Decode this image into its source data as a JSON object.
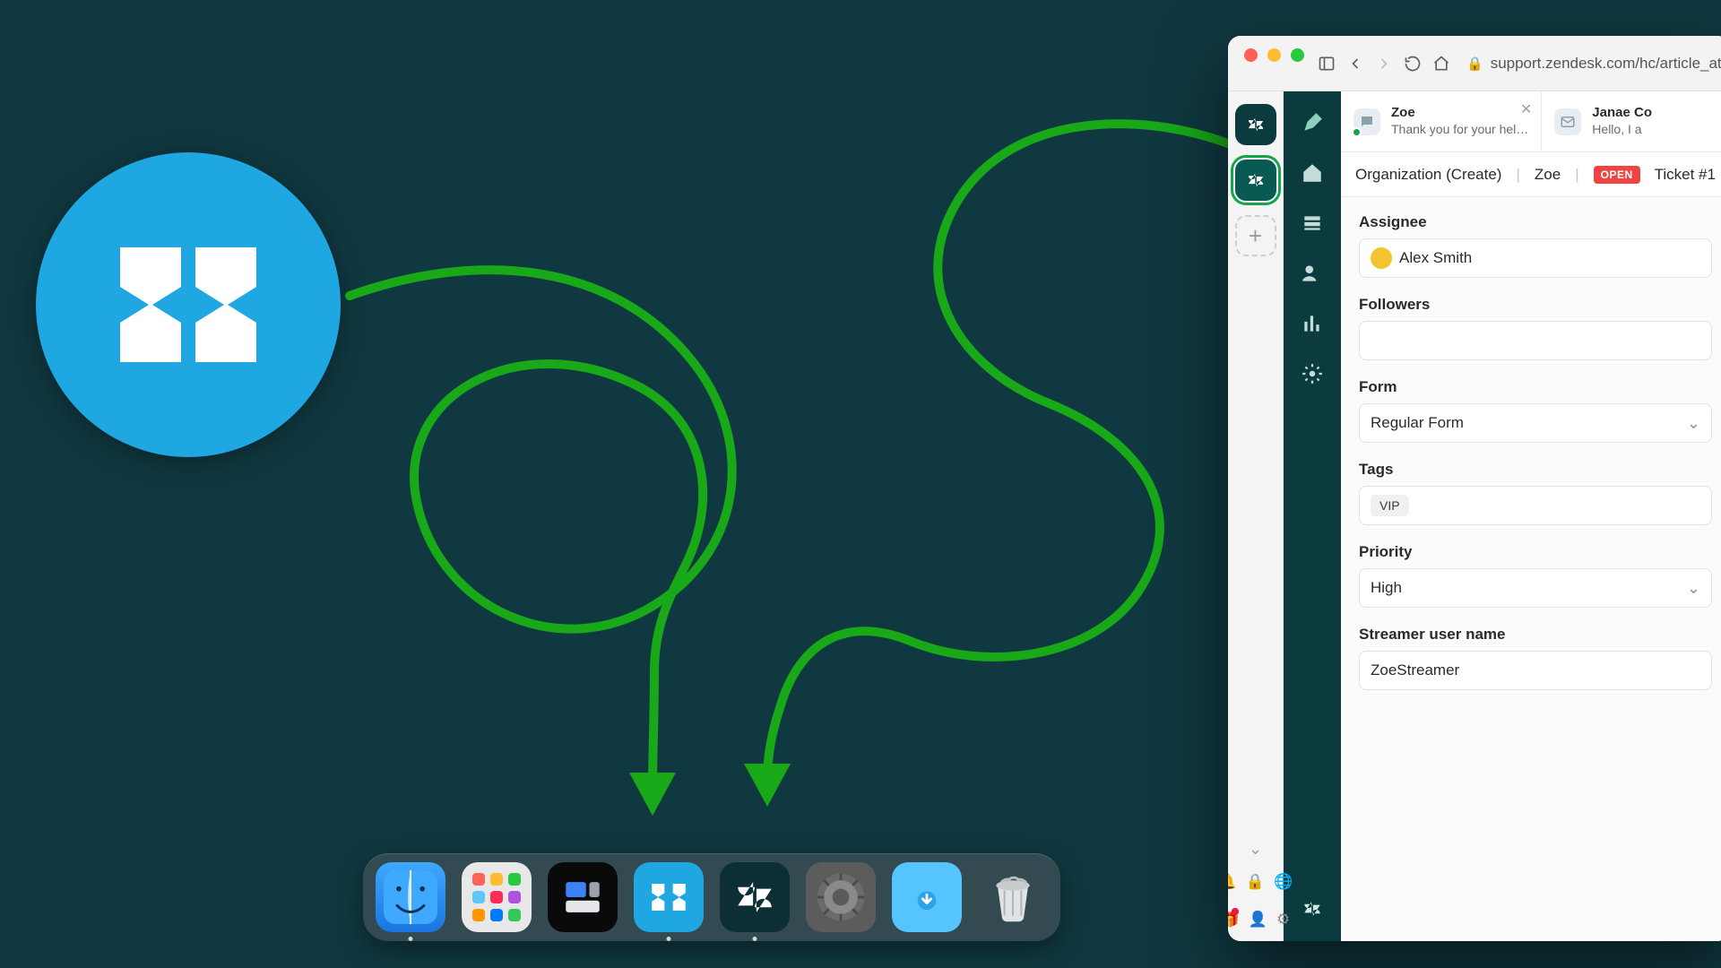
{
  "browser": {
    "url": "support.zendesk.com/hc/article_attachm"
  },
  "sidebar_rail": {
    "add_label": "+"
  },
  "tabs": [
    {
      "name": "Zoe",
      "subtitle": "Thank you for your hel…",
      "has_presence": true,
      "avatar_kind": "chat"
    },
    {
      "name": "Janae Co",
      "subtitle": "Hello, I a",
      "has_presence": false,
      "avatar_kind": "mail"
    }
  ],
  "crumbs": {
    "org": "Organization (Create)",
    "user": "Zoe",
    "status": "OPEN",
    "ticket": "Ticket #1"
  },
  "form": {
    "assignee_label": "Assignee",
    "assignee_value": "Alex Smith",
    "followers_label": "Followers",
    "followers_value": "",
    "form_label": "Form",
    "form_value": "Regular Form",
    "tags_label": "Tags",
    "tags_value": "VIP",
    "priority_label": "Priority",
    "priority_value": "High",
    "streamer_label": "Streamer user name",
    "streamer_value": "ZoeStreamer"
  },
  "dock": {
    "items": [
      "finder",
      "launchpad",
      "mission-control",
      "wavebox",
      "zendesk",
      "system-settings",
      "downloads",
      "trash"
    ]
  }
}
